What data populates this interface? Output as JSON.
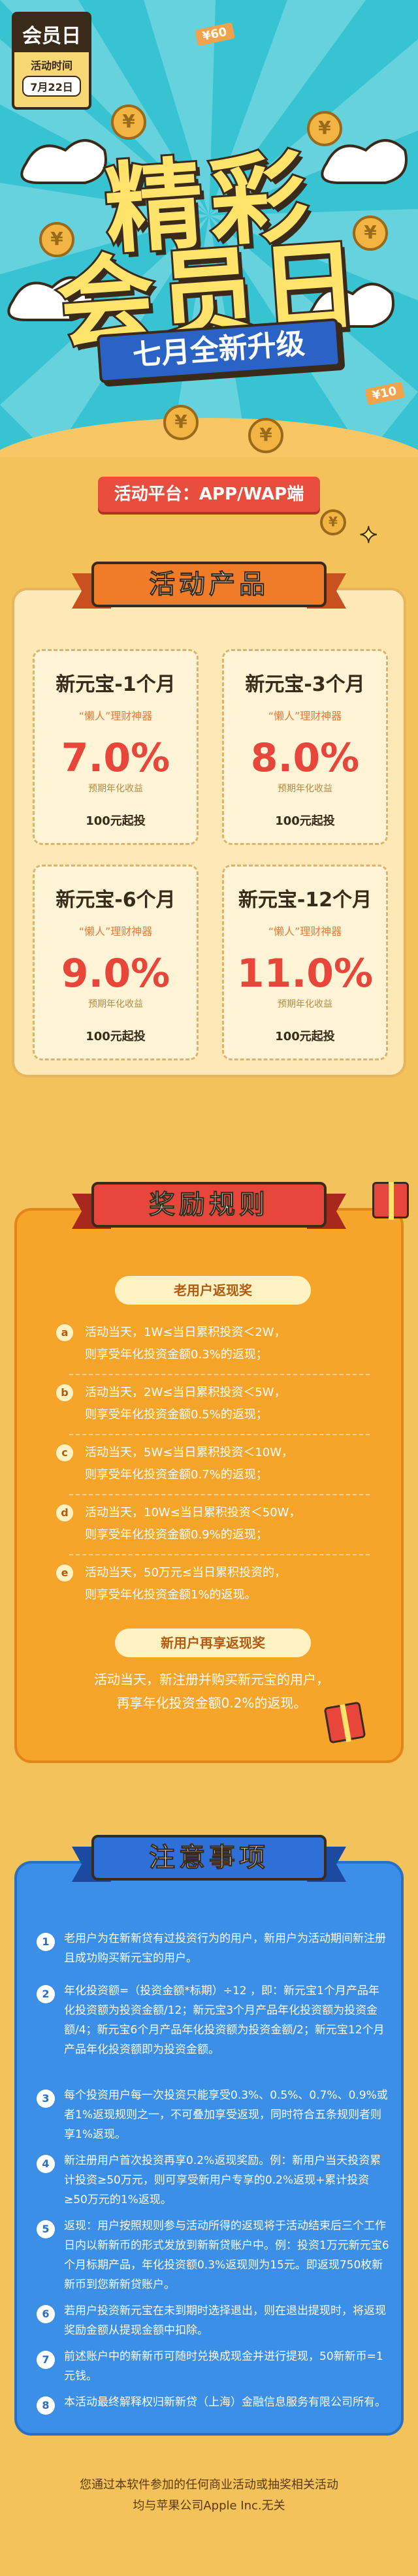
{
  "hero": {
    "badge_title": "会员日",
    "badge_sub": "活动时间",
    "badge_date": "7月22日",
    "title_line1": "精彩",
    "title_line2": "会员日",
    "subtitle": "七月全新升级",
    "tag_60": "¥60",
    "tag_10": "¥10",
    "coin_symbol": "¥"
  },
  "platform": "活动平台：APP/WAP端",
  "products": {
    "title": "活动产品",
    "items": [
      {
        "name": "新元宝-1个月",
        "slogan": "“懒人”理财神器",
        "rate": "7.0%",
        "rate_label": "预期年化收益",
        "min": "100元起投"
      },
      {
        "name": "新元宝-3个月",
        "slogan": "“懒人”理财神器",
        "rate": "8.0%",
        "rate_label": "预期年化收益",
        "min": "100元起投"
      },
      {
        "name": "新元宝-6个月",
        "slogan": "“懒人”理财神器",
        "rate": "9.0%",
        "rate_label": "预期年化收益",
        "min": "100元起投"
      },
      {
        "name": "新元宝-12个月",
        "slogan": "“懒人”理财神器",
        "rate": "11.0%",
        "rate_label": "预期年化收益",
        "min": "100元起投"
      }
    ]
  },
  "reward": {
    "title": "奖励规则",
    "old_user_label": "老用户返现奖",
    "rules": [
      {
        "mark": "a",
        "line1": "活动当天，1W≤当日累积投资＜2W，",
        "line2": "则享受年化投资金额0.3%的返现；"
      },
      {
        "mark": "b",
        "line1": "活动当天，2W≤当日累积投资＜5W，",
        "line2": "则享受年化投资金额0.5%的返现；"
      },
      {
        "mark": "c",
        "line1": "活动当天，5W≤当日累积投资＜10W，",
        "line2": "则享受年化投资金额0.7%的返现；"
      },
      {
        "mark": "d",
        "line1": "活动当天，10W≤当日累积投资＜50W，",
        "line2": "则享受年化投资金额0.9%的返现；"
      },
      {
        "mark": "e",
        "line1": "活动当天，50万元≤当日累积投资的，",
        "line2": "则享受年化投资金额1%的返现。"
      }
    ],
    "new_user_label": "新用户再享返现奖",
    "new_user_line1": "活动当天，新注册并购买新元宝的用户，",
    "new_user_line2": "再享年化投资金额0.2%的返现。"
  },
  "notes": {
    "title": "注意事项",
    "items": [
      {
        "num": "1",
        "text": "老用户为在新新贷有过投资行为的用户，新用户为活动期间新注册且成功购买新元宝的用户。"
      },
      {
        "num": "2",
        "text": "年化投资额=（投资金额*标期）÷12 ，即：新元宝1个月产品年化投资额为投资金额/12；新元宝3个月产品年化投资额为投资金额/4；新元宝6个月产品年化投资额为投资金额/2；新元宝12个月产品年化投资额即为投资金额。"
      },
      {
        "num": "3",
        "text": "每个投资用户每一次投资只能享受0.3%、0.5%、0.7%、0.9%或者1%返现规则之一，不可叠加享受返现，同时符合五条规则者则享1%返现。"
      },
      {
        "num": "4",
        "text": "新注册用户首次投资再享0.2%返现奖励。例：新用户当天投资累计投资≥50万元，则可享受新用户专享的0.2%返现+累计投资≥50万元的1%返现。"
      },
      {
        "num": "5",
        "text": "返现：用户按照规则参与活动所得的返现将于活动结束后三个工作日内以新新币的形式发放到新新贷账户中。例：投资1万元新元宝6个月标期产品，年化投资额0.3%返现则为15元。即返现750枚新新币到您新新贷账户。"
      },
      {
        "num": "6",
        "text": "若用户投资新元宝在未到期时选择退出，则在退出提现时，将返现奖励金额从提现金额中扣除。"
      },
      {
        "num": "7",
        "text": "前述账户中的新新币可随时兑换成现金并进行提现，50新新币=1元钱。"
      },
      {
        "num": "8",
        "text": "本活动最终解释权归新新贷（上海）金融信息服务有限公司所有。"
      }
    ]
  },
  "footer": {
    "line1": "您通过本软件参加的任何商业活动或抽奖相关活动",
    "line2": "均与苹果公司Apple Inc.无关"
  },
  "colors": {
    "hero_bg": "#38c3d3",
    "page_bg": "#f4c25a",
    "accent_red": "#e8463a",
    "accent_orange": "#f7a52a",
    "accent_blue": "#3b8fe6"
  }
}
